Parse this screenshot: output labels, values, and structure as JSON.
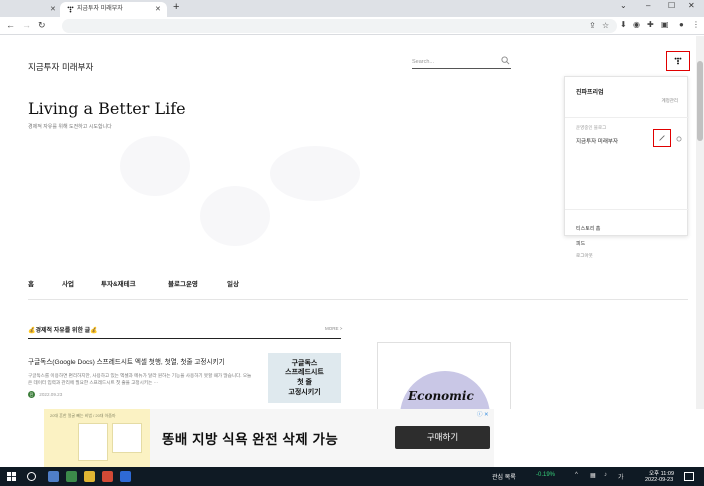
{
  "browser": {
    "tabs": [
      {
        "label": "",
        "active": false
      },
      {
        "label": "지금투자 미래부자",
        "active": true
      }
    ],
    "new_tab": "+",
    "window_controls": {
      "minimize": "–",
      "maximize": "☐",
      "close": "✕"
    }
  },
  "blog": {
    "name": "지금투자 미래부자",
    "search_placeholder": "Search...",
    "hero_title": "Living a Better Life",
    "hero_subtitle": "경제적 자유를 위해 도전하고 시도합니다"
  },
  "nav": {
    "items": [
      "홈",
      "사업",
      "투자&재테크",
      "블로그운영",
      "일상"
    ]
  },
  "section": {
    "title": "💰경제적 자유를 위한 글💰",
    "more": "MORE >"
  },
  "post": {
    "title": "구글독스(Google Docs) 스프레드시트 엑셀 첫행, 첫열, 첫줄 고정시키기",
    "excerpt": "구글독스를 이용하면 편리하지만, 사용하고 있는 엑셀과 메뉴가 달라 원하는 기능을 사용하기 못할 때가 많습니다. 오늘은 데이터 입력과 관리에 필요한 스프레드시트 첫 줄을 고정시키는 ···",
    "author_initial": "진",
    "date": "2022.09.23",
    "thumb_lines": [
      "구글독스",
      "스프레드시트",
      "첫 줄",
      "고정시키기"
    ]
  },
  "side_card": {
    "logo_text": "Economic"
  },
  "dropdown": {
    "user_name": "진파프리엄",
    "account_link": "계정관리",
    "blogs_caption": "운영중인 블로그",
    "blog_title": "지금투자 미래부자",
    "tistory_home": "티스토리 홈",
    "feed": "피드",
    "logout": "로그아웃"
  },
  "ad": {
    "caption": "20대 흔한 얼굴 빼는 비법 / 20대 아줌마",
    "headline": "똥배 지방 식욕 완전 삭제 가능",
    "button": "구매하기",
    "info": "ⓘ ✕"
  },
  "taskbar": {
    "stock_label": "관심 목록",
    "stock_value": "-0.19%",
    "time": "오후 11:09",
    "date": "2022-09-23"
  },
  "colors": {
    "highlight": "#e00000",
    "taskbar": "#0f1a24",
    "ad_button": "#2d2d2d",
    "econ_circle": "#c9c7e6"
  }
}
